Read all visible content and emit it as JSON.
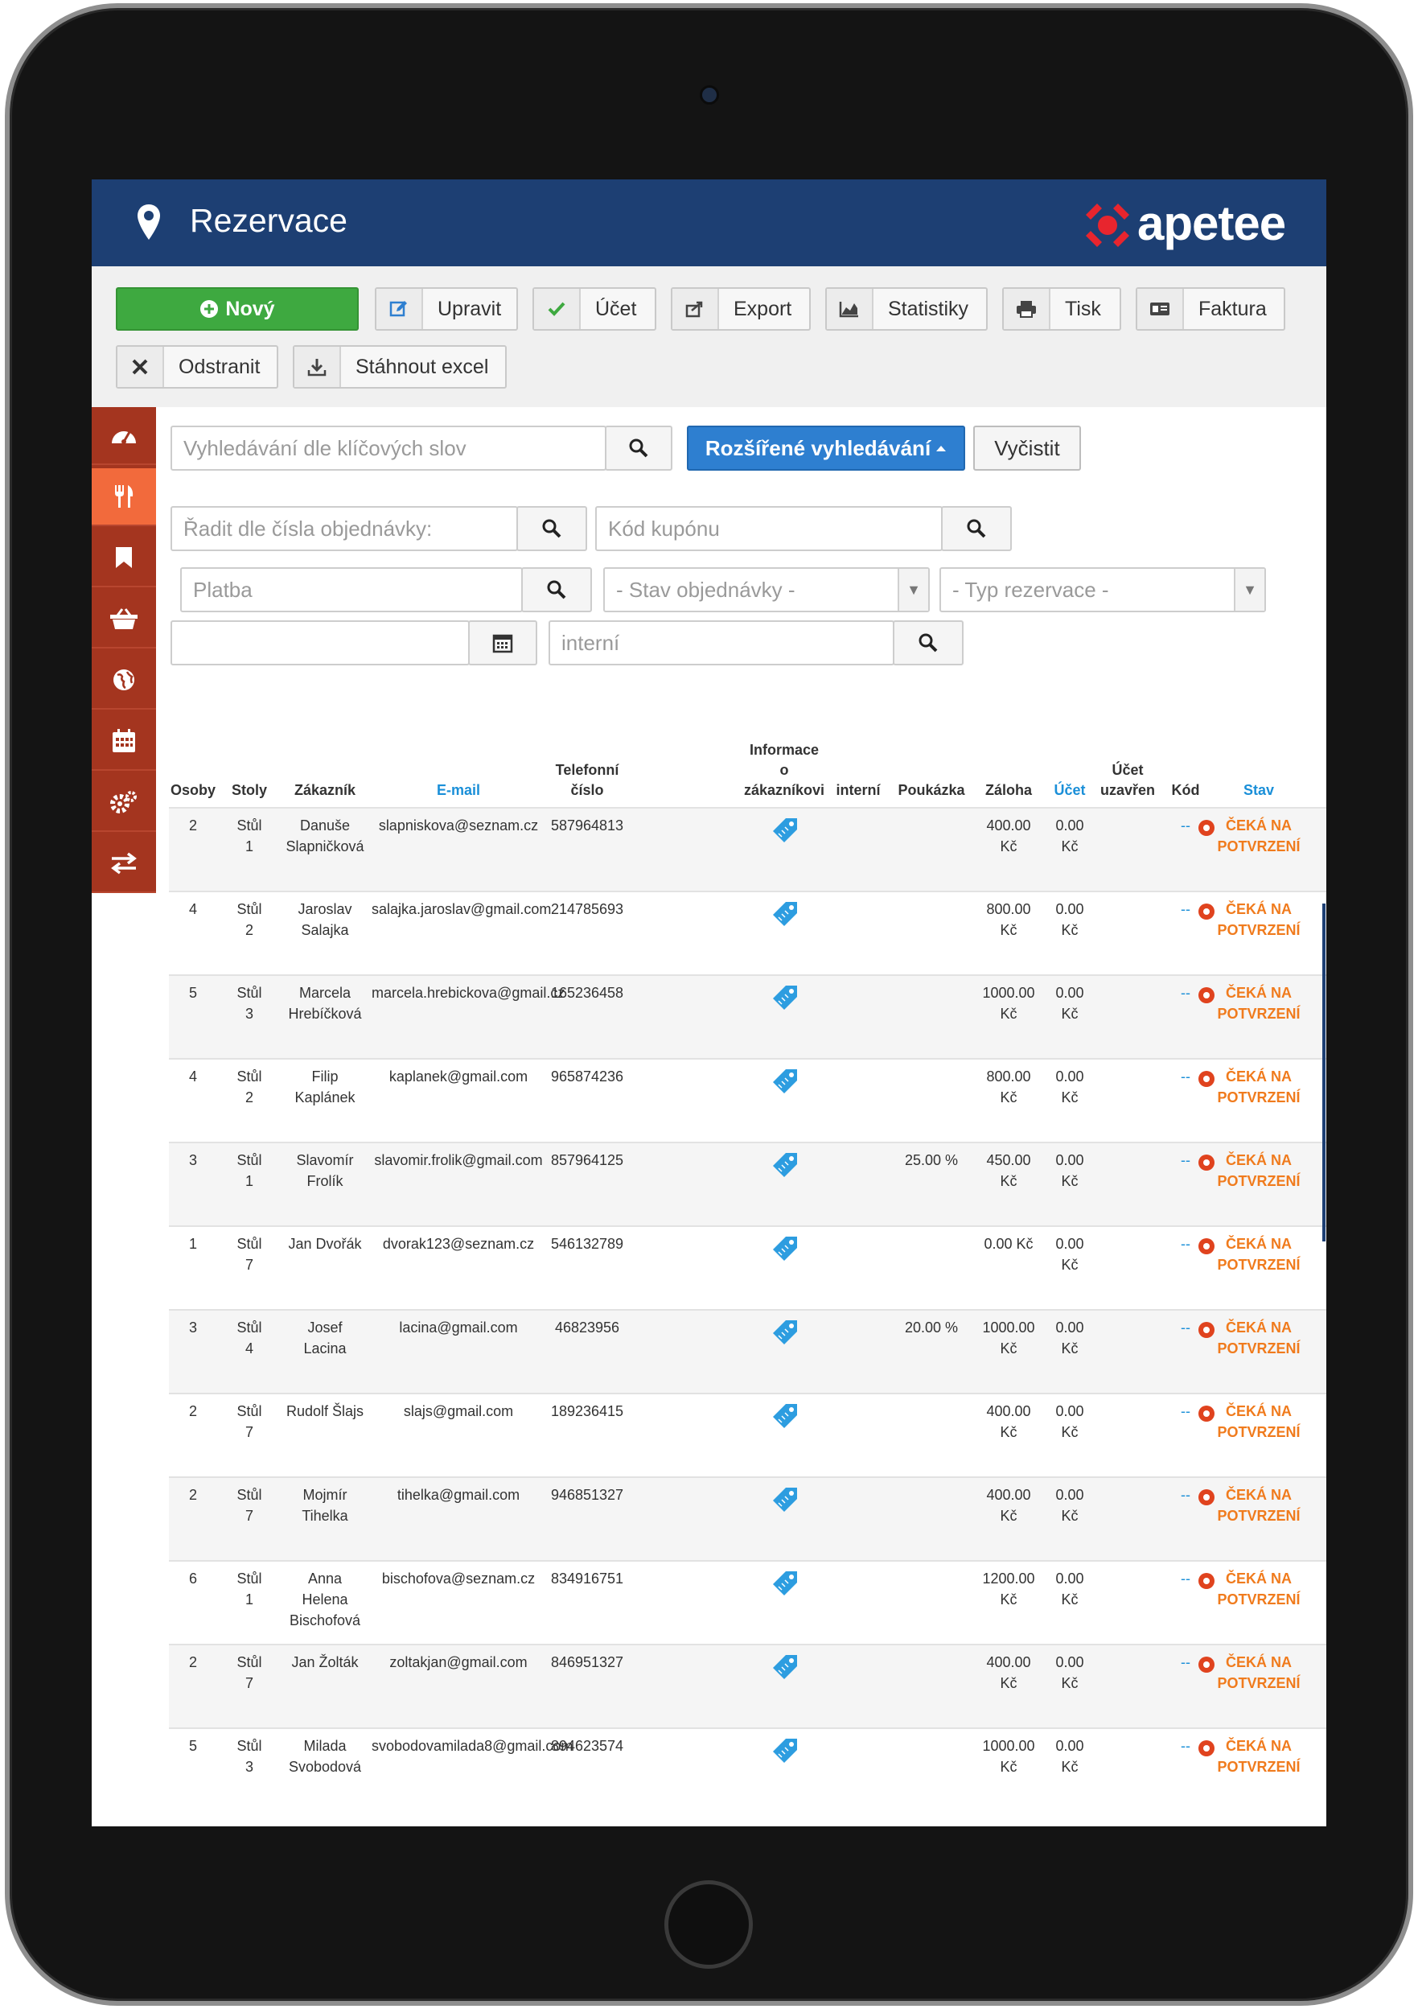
{
  "header": {
    "title": "Rezervace",
    "logo_text": "apetee"
  },
  "toolbar": {
    "new": "Nový",
    "edit": "Upravit",
    "account": "Účet",
    "export": "Export",
    "stats": "Statistiky",
    "print": "Tisk",
    "invoice": "Faktura",
    "delete": "Odstranit",
    "download_excel": "Stáhnout excel"
  },
  "search": {
    "keywords_placeholder": "Vyhledávání dle klíčových slov",
    "advanced": "Rozšířené vyhledávání",
    "clear": "Vyčistit",
    "order_placeholder": "Řadit dle čísla objednávky:",
    "coupon_placeholder": "Kód kupónu",
    "payment_placeholder": "Platba",
    "order_state": "- Stav objednávky -",
    "reservation_type": "- Typ rezervace -",
    "internal_placeholder": "interní"
  },
  "table": {
    "headers": {
      "persons": "Osoby",
      "tables": "Stoly",
      "customer": "Zákazník",
      "email": "E-mail",
      "phone_line1": "Telefonní",
      "phone_line2": "číslo",
      "info_line1": "Informace",
      "info_line2": "o",
      "info_line3": "zákazníkovi",
      "internal": "interní",
      "voucher": "Poukázka",
      "deposit": "Záloha",
      "account": "Účet",
      "closed_line1": "Účet",
      "closed_line2": "uzavřen",
      "code": "Kód",
      "state": "Stav"
    },
    "rows": [
      {
        "persons": "2",
        "table1": "Stůl",
        "table2": "1",
        "name1": "Danuše",
        "name2": "Slapničková",
        "name3": "",
        "email": "slapniskova@seznam.cz",
        "phone": "587964813",
        "voucher": "",
        "dep1": "400.00",
        "dep2": "Kč",
        "acc1": "0.00",
        "acc2": "Kč",
        "code": "--",
        "st1": "ČEKÁ NA",
        "st2": "POTVRZENÍ",
        "badge": "Č"
      },
      {
        "persons": "4",
        "table1": "Stůl",
        "table2": "2",
        "name1": "Jaroslav",
        "name2": "Salajka",
        "name3": "",
        "email": "salajka.jaroslav@gmail.com",
        "phone": "214785693",
        "voucher": "",
        "dep1": "800.00",
        "dep2": "Kč",
        "acc1": "0.00",
        "acc2": "Kč",
        "code": "--",
        "st1": "ČEKÁ NA",
        "st2": "POTVRZENÍ",
        "badge": "Č"
      },
      {
        "persons": "5",
        "table1": "Stůl",
        "table2": "3",
        "name1": "Marcela",
        "name2": "Hrebíčková",
        "name3": "",
        "email": "marcela.hrebickova@gmail.cz",
        "phone": "165236458",
        "voucher": "",
        "dep1": "1000.00",
        "dep2": "Kč",
        "acc1": "0.00",
        "acc2": "Kč",
        "code": "--",
        "st1": "ČEKÁ NA",
        "st2": "POTVRZENÍ",
        "badge": "Č"
      },
      {
        "persons": "4",
        "table1": "Stůl",
        "table2": "2",
        "name1": "Filip",
        "name2": "Kaplánek",
        "name3": "",
        "email": "kaplanek@gmail.com",
        "phone": "965874236",
        "voucher": "",
        "dep1": "800.00",
        "dep2": "Kč",
        "acc1": "0.00",
        "acc2": "Kč",
        "code": "--",
        "st1": "ČEKÁ NA",
        "st2": "POTVRZENÍ",
        "badge": "Č"
      },
      {
        "persons": "3",
        "table1": "Stůl",
        "table2": "1",
        "name1": "Slavomír",
        "name2": "Frolík",
        "name3": "",
        "email": "slavomir.frolik@gmail.com",
        "phone": "857964125",
        "voucher": "25.00 %",
        "dep1": "450.00",
        "dep2": "Kč",
        "acc1": "0.00",
        "acc2": "Kč",
        "code": "--",
        "st1": "ČEKÁ NA",
        "st2": "POTVRZENÍ",
        "badge": "Č"
      },
      {
        "persons": "1",
        "table1": "Stůl",
        "table2": "7",
        "name1": "Jan Dvořák",
        "name2": "",
        "name3": "",
        "email": "dvorak123@seznam.cz",
        "phone": "546132789",
        "voucher": "",
        "dep1": "0.00 Kč",
        "dep2": "",
        "acc1": "0.00",
        "acc2": "Kč",
        "code": "--",
        "st1": "ČEKÁ NA",
        "st2": "POTVRZENÍ",
        "badge": "Č"
      },
      {
        "persons": "3",
        "table1": "Stůl",
        "table2": "4",
        "name1": "Josef",
        "name2": "Lacina",
        "name3": "",
        "email": "lacina@gmail.com",
        "phone": "46823956",
        "voucher": "20.00 %",
        "dep1": "1000.00",
        "dep2": "Kč",
        "acc1": "0.00",
        "acc2": "Kč",
        "code": "--",
        "st1": "ČEKÁ NA",
        "st2": "POTVRZENÍ",
        "badge": "Č"
      },
      {
        "persons": "2",
        "table1": "Stůl",
        "table2": "7",
        "name1": "Rudolf Šlajs",
        "name2": "",
        "name3": "",
        "email": "slajs@gmail.com",
        "phone": "189236415",
        "voucher": "",
        "dep1": "400.00",
        "dep2": "Kč",
        "acc1": "0.00",
        "acc2": "Kč",
        "code": "--",
        "st1": "ČEKÁ NA",
        "st2": "POTVRZENÍ",
        "badge": "Č"
      },
      {
        "persons": "2",
        "table1": "Stůl",
        "table2": "7",
        "name1": "Mojmír",
        "name2": "Tihelka",
        "name3": "",
        "email": "tihelka@gmail.com",
        "phone": "946851327",
        "voucher": "",
        "dep1": "400.00",
        "dep2": "Kč",
        "acc1": "0.00",
        "acc2": "Kč",
        "code": "--",
        "st1": "ČEKÁ NA",
        "st2": "POTVRZENÍ",
        "badge": "Č"
      },
      {
        "persons": "6",
        "table1": "Stůl",
        "table2": "1",
        "name1": "Anna",
        "name2": "Helena",
        "name3": "Bischofová",
        "email": "bischofova@seznam.cz",
        "phone": "834916751",
        "voucher": "",
        "dep1": "1200.00",
        "dep2": "Kč",
        "acc1": "0.00",
        "acc2": "Kč",
        "code": "--",
        "st1": "ČEKÁ NA",
        "st2": "POTVRZENÍ",
        "badge": "Č"
      },
      {
        "persons": "2",
        "table1": "Stůl",
        "table2": "7",
        "name1": "Jan Žolták",
        "name2": "",
        "name3": "",
        "email": "zoltakjan@gmail.com",
        "phone": "846951327",
        "voucher": "",
        "dep1": "400.00",
        "dep2": "Kč",
        "acc1": "0.00",
        "acc2": "Kč",
        "code": "--",
        "st1": "ČEKÁ NA",
        "st2": "POTVRZENÍ",
        "badge": "Č"
      },
      {
        "persons": "5",
        "table1": "Stůl",
        "table2": "3",
        "name1": "Milada",
        "name2": "Svobodová",
        "name3": "",
        "email": "svobodovamilada8@gmail.com",
        "phone": "894623574",
        "voucher": "",
        "dep1": "1000.00",
        "dep2": "Kč",
        "acc1": "0.00",
        "acc2": "Kč",
        "code": "--",
        "st1": "ČEKÁ NA",
        "st2": "POTVRZENÍ",
        "badge": "Č"
      }
    ]
  },
  "colors": {
    "header_bg": "#1d3f73",
    "sidebar_bg": "#a4351f",
    "sidebar_active": "#f26a3c",
    "accent_blue": "#2e7fd0",
    "status_orange": "#f07b1d",
    "new_green": "#3ea940"
  }
}
